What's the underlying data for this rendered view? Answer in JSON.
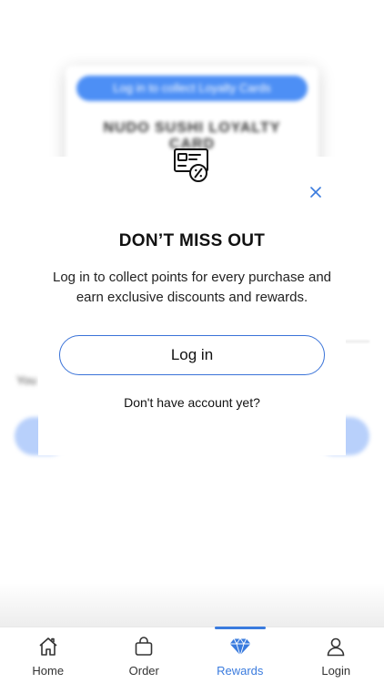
{
  "background": {
    "card_button_label": "Log in to collect Loyalty Cards",
    "card_title": "NUDO SUSHI LOYALTY CARD",
    "side_text": "You"
  },
  "modal": {
    "icon": "loyalty-card-discount-icon",
    "close_icon": "close-icon",
    "title": "DON’T MISS OUT",
    "body": "Log in to collect points for every purchase and earn exclusive discounts and rewards.",
    "login_label": "Log in",
    "signup_link": "Don't have account yet?"
  },
  "tabs": [
    {
      "label": "Home",
      "icon": "home-icon",
      "active": false
    },
    {
      "label": "Order",
      "icon": "bag-icon",
      "active": false
    },
    {
      "label": "Rewards",
      "icon": "diamond-icon",
      "active": true
    },
    {
      "label": "Login",
      "icon": "user-icon",
      "active": false
    }
  ],
  "colors": {
    "accent": "#3a7bde",
    "button_border": "#3a73d8",
    "blurred_button": "#4d8ff5"
  }
}
